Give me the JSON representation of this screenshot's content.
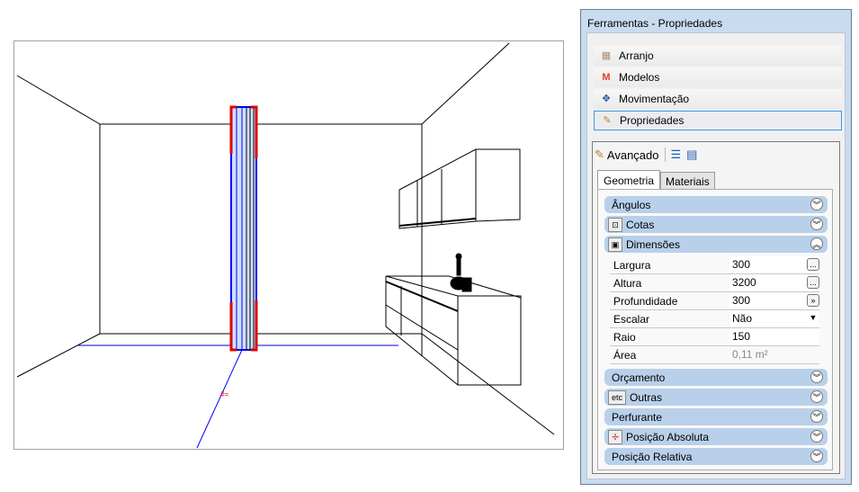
{
  "panel": {
    "title": "Ferramentas - Propriedades",
    "nav": [
      {
        "label": "Arranjo",
        "icon": "grid-icon"
      },
      {
        "label": "Modelos",
        "icon": "m-logo-icon"
      },
      {
        "label": "Movimentação",
        "icon": "move-icon"
      },
      {
        "label": "Propriedades",
        "icon": "properties-icon"
      }
    ],
    "toolbar": {
      "label": "Avançado"
    },
    "tabs": [
      "Geometria",
      "Materiais"
    ],
    "groups": {
      "angulos": "Ângulos",
      "cotas": "Cotas",
      "dimensoes": "Dimensões",
      "orcamento": "Orçamento",
      "outras": "Outras",
      "outras_icon": "etc",
      "perfurante": "Perfurante",
      "pos_abs": "Posição Absoluta",
      "pos_rel": "Posição Relativa"
    },
    "props": [
      {
        "key": "Largura",
        "value": "300",
        "btn": "..."
      },
      {
        "key": "Altura",
        "value": "3200",
        "btn": "..."
      },
      {
        "key": "Profundidade",
        "value": "300",
        "btn": "»"
      },
      {
        "key": "Escalar",
        "value": "Não",
        "btn": "▼"
      },
      {
        "key": "Raio",
        "value": "150"
      },
      {
        "key": "Área",
        "value": "0,11 m²"
      }
    ]
  }
}
